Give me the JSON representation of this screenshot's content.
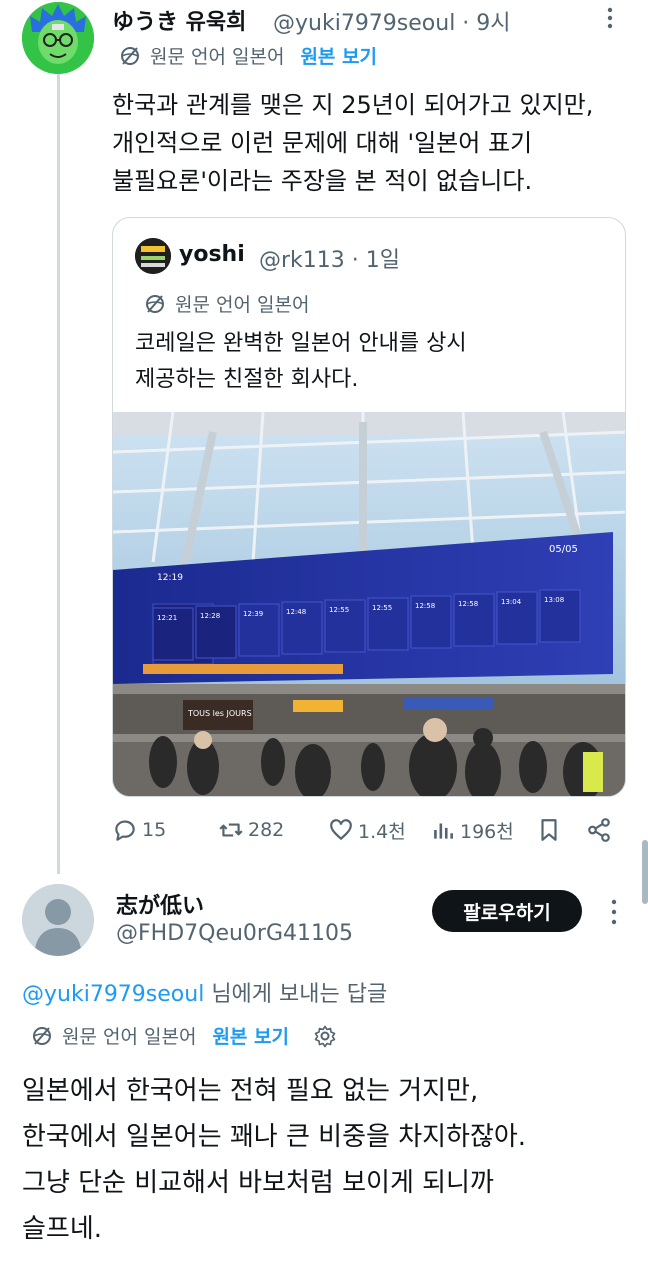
{
  "tweet": {
    "author_name": "ゆうき 유욱희",
    "author_handle": "@yuki7979seoul · 9시",
    "translation_label": "원문 언어 일본어",
    "show_original": "원본 보기",
    "text": "한국과 관계를 맺은 지 25년이 되어가고 있지만,\n개인적으로 이런 문제에 대해 '일본어 표기\n불필요론'이라는 주장을 본 적이 없습니다.",
    "quote": {
      "author_name": "yoshi",
      "author_handle": "@rk113 · 1일",
      "translation_label": "원문 언어 일본어",
      "text": "코레일은 완벽한 일본어 안내를 상시\n제공하는 친절한 회사다.",
      "photo": {
        "board_time": "12:19",
        "board_date": "05/05",
        "bakery_sign": "TOUS les JOURS",
        "departure_times": [
          "12:21",
          "12:28",
          "12:39",
          "12:48",
          "12:55",
          "12:55",
          "12:58",
          "12:58",
          "13:04",
          "13:08"
        ]
      }
    },
    "actions": {
      "replies": "15",
      "reposts": "282",
      "likes": "1.4천",
      "views": "196천"
    }
  },
  "reply": {
    "author_name": "志が低い",
    "author_handle": "@FHD7Qeu0rG41105",
    "follow_label": "팔로우하기",
    "replying_to_mention": "@yuki7979seoul",
    "replying_to_suffix": " 님에게 보내는 답글",
    "translation_label": "원문 언어 일본어",
    "show_original": "원본 보기",
    "text": "일본에서 한국어는 전혀 필요 없는 거지만,\n한국에서 일본어는 꽤나 큰 비중을 차지하잖아.\n그냥 단순 비교해서 바보처럼 보이게 되니까\n슬프네."
  },
  "colors": {
    "accent": "#1d9bf0",
    "muted": "#536471",
    "text": "#0f1419",
    "border": "#cfd9de"
  }
}
